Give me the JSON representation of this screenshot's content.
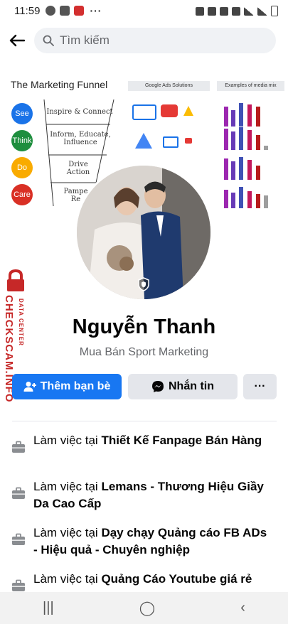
{
  "status_bar": {
    "time": "11:59",
    "more": "···"
  },
  "search": {
    "placeholder": "Tìm kiếm"
  },
  "cover": {
    "funnel_title": "The Marketing Funnel",
    "google_ads_title": "Google Ads Solutions",
    "media_mix_title": "Examples of media mix",
    "stages": [
      "See",
      "Think",
      "Do",
      "Care"
    ],
    "stage_texts": [
      "Inspire & Connect",
      "Inform, Educate, Influence",
      "Drive Action",
      "Pampe Re"
    ],
    "colors": {
      "see": "#1a73e8",
      "think": "#1e8e3e",
      "do": "#f9ab00",
      "care": "#d93025"
    }
  },
  "profile": {
    "name": "Nguyễn Thanh",
    "subtitle": "Mua Bán Sport Marketing"
  },
  "watermark": {
    "brand": "CHECKSCAM.INFO",
    "sub": "DATA CENTER"
  },
  "actions": {
    "add_friend": "Thêm bạn bè",
    "message": "Nhắn tin",
    "more": "···"
  },
  "work": [
    {
      "prefix": "Làm việc tại ",
      "place": "Thiết Kế Fanpage Bán Hàng"
    },
    {
      "prefix": "Làm việc tại ",
      "place": "Lemans - Thương Hiệu Giầy Da Cao Cấp"
    },
    {
      "prefix": "Làm việc tại ",
      "place": "Dạy chạy Quảng cáo FB ADs - Hiệu quả - Chuyên nghiệp"
    },
    {
      "prefix": "Làm việc tại ",
      "place": "Quảng Cáo Youtube giá rẻ"
    }
  ],
  "nav": {
    "recents": "|||",
    "home": "◯",
    "back": "‹"
  },
  "colors": {
    "accent": "#1877f2",
    "secondary_button": "#e4e6eb",
    "watermark": "#c62828"
  }
}
